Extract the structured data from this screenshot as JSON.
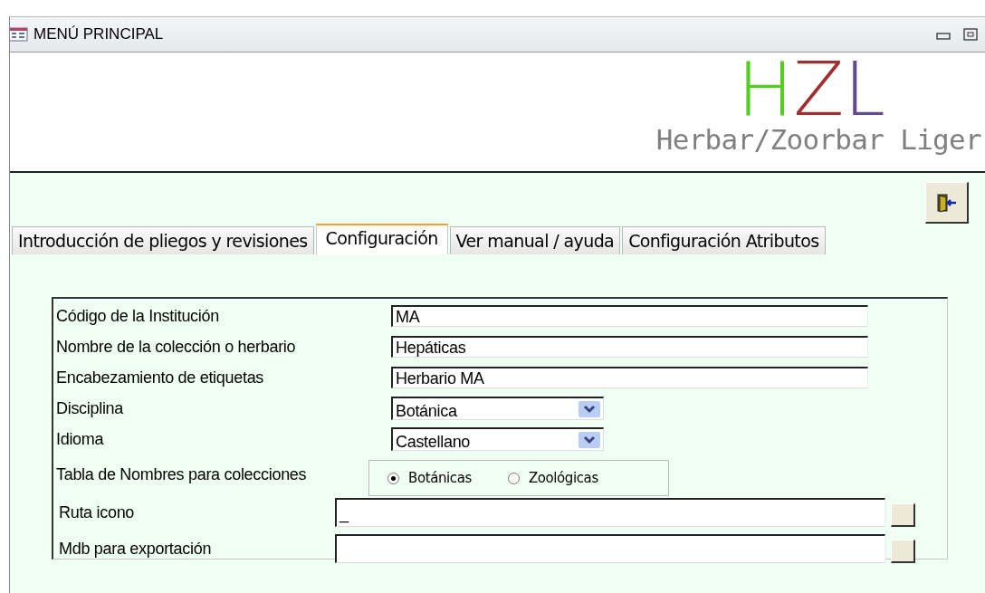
{
  "window": {
    "title": "MENÚ PRINCIPAL"
  },
  "logo": {
    "letters": [
      {
        "text": "H",
        "color": "#55cc22"
      },
      {
        "text": "Z",
        "color": "#a03030"
      },
      {
        "text": "L",
        "color": "#604a90"
      }
    ],
    "subtitle": "Herbar/Zoorbar Liger"
  },
  "tabs": [
    {
      "label": "Introducción de pliegos y revisiones",
      "selected": false
    },
    {
      "label": "Configuración",
      "selected": true
    },
    {
      "label": "Ver manual / ayuda",
      "selected": false
    },
    {
      "label": "Configuración Atributos",
      "selected": false
    }
  ],
  "fields": [
    {
      "kind": "text",
      "label": "Código de la Institución",
      "value": "MA"
    },
    {
      "kind": "text",
      "label": "Nombre de la colección o herbario",
      "value": "Hepáticas"
    },
    {
      "kind": "text",
      "label": "Encabezamiento de etiquetas",
      "value": "Herbario MA"
    },
    {
      "kind": "select",
      "label": "Disciplina",
      "value": "Botánica"
    },
    {
      "kind": "select",
      "label": "Idioma",
      "value": "Castellano"
    },
    {
      "kind": "radio",
      "label": "Tabla de Nombres para colecciones",
      "options": [
        {
          "label": "Botánicas",
          "selected": true
        },
        {
          "label": "Zoológicas",
          "selected": false
        }
      ]
    },
    {
      "kind": "path",
      "label": "Ruta icono",
      "value": "_"
    },
    {
      "kind": "path",
      "label": "Mdb para exportación"
    }
  ]
}
